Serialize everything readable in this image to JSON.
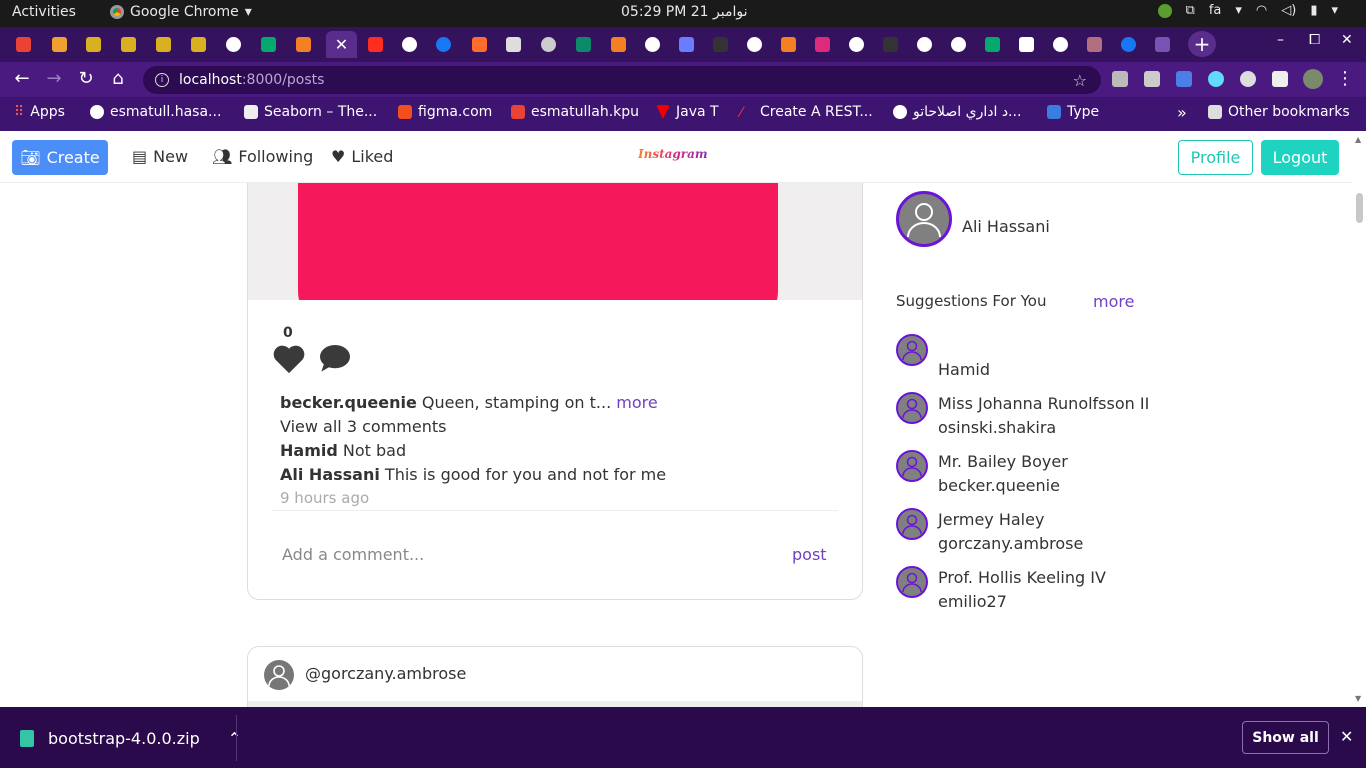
{
  "gnome": {
    "activities": "Activities",
    "app_name": "Google Chrome",
    "clock": "05:29 PM  21 نوامبر",
    "lang": "fa"
  },
  "browser": {
    "url_host": "localhost",
    "url_path": ":8000/posts",
    "tab_count": 34
  },
  "bookmarks": [
    {
      "label": "Apps"
    },
    {
      "label": "esmatull.hasa..."
    },
    {
      "label": "Seaborn – The..."
    },
    {
      "label": "figma.com"
    },
    {
      "label": "esmatullah.kpu"
    },
    {
      "label": "Java T"
    },
    {
      "label": "Create A REST..."
    },
    {
      "label": "د اداري اصلاحاتو..."
    },
    {
      "label": "Type"
    },
    {
      "label": "»"
    },
    {
      "label": "Other bookmarks"
    }
  ],
  "navbar": {
    "create": "Create",
    "new": "New",
    "following": "Following",
    "liked": "Liked",
    "brand": "Instagram",
    "profile": "Profile",
    "logout": "Logout"
  },
  "post": {
    "like_count": "0",
    "caption_user": "becker.queenie",
    "caption_text": " Queen, stamping on t...",
    "caption_more": " more",
    "view_comments": "View all 3 comments",
    "comments": [
      {
        "user": "Hamid",
        "text": " Not bad"
      },
      {
        "user": "Ali Hassani",
        "text": " This is good for you and not for me"
      }
    ],
    "time_ago": "9 hours ago",
    "add_comment_placeholder": "Add a comment...",
    "post_label": "post"
  },
  "next_post": {
    "username": "@gorczany.ambrose"
  },
  "sidebar": {
    "current_user": "Ali Hassani",
    "suggestions_title": "Suggestions For You",
    "more": "more",
    "suggestions": [
      {
        "name": "",
        "username": "Hamid"
      },
      {
        "name": "Miss Johanna Runolfsson II",
        "username": "osinski.shakira"
      },
      {
        "name": "Mr. Bailey Boyer",
        "username": "becker.queenie"
      },
      {
        "name": "Jermey Haley",
        "username": "gorczany.ambrose"
      },
      {
        "name": "Prof. Hollis Keeling IV",
        "username": "emilio27"
      }
    ]
  },
  "downloads": {
    "file": "bootstrap-4.0.0.zip",
    "show_all": "Show all"
  }
}
